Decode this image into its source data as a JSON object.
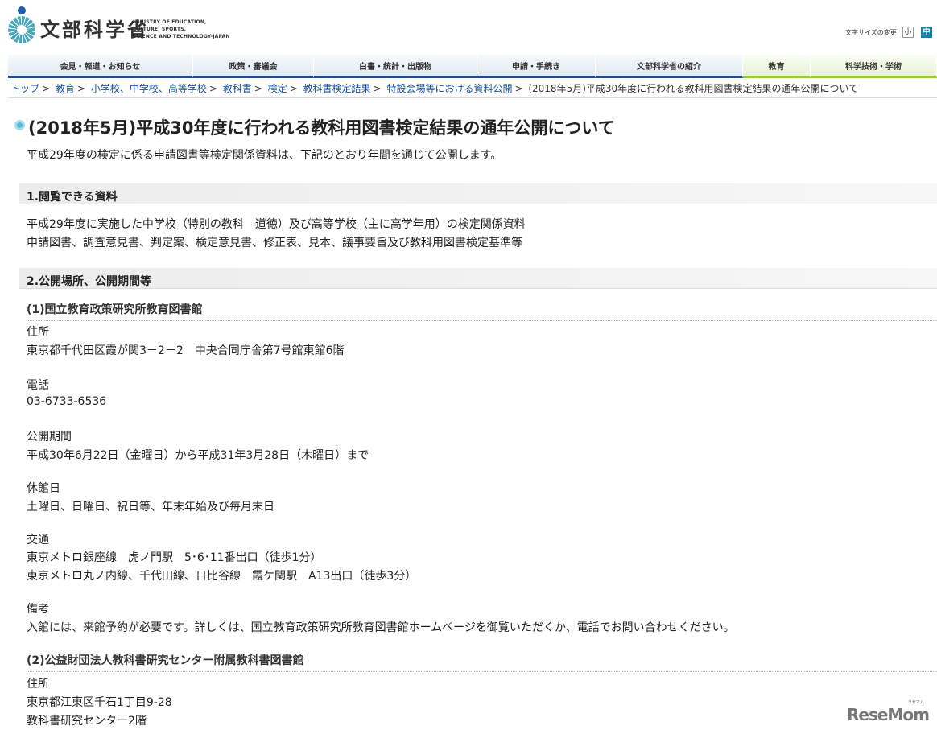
{
  "header": {
    "logo_jp": "文部科学省",
    "logo_en": [
      "MINISTRY OF EDUCATION,",
      "CULTURE, SPORTS,",
      "SCIENCE AND TECHNOLOGY-JAPAN"
    ],
    "font_size_label": "文字サイズの変更",
    "font_small": "小",
    "font_medium": "中"
  },
  "nav": [
    "会見・報道・お知らせ",
    "政策・審議会",
    "白書・統計・出版物",
    "申請・手続き",
    "文部科学省の紹介",
    "教育",
    "科学技術・学術"
  ],
  "breadcrumb": [
    "トップ",
    "教育",
    "小学校、中学校、高等学校",
    "教科書",
    "検定",
    "教科書検定結果",
    "特設会場等における資料公開"
  ],
  "breadcrumb_current": "(2018年5月)平成30年度に行われる教科用図書検定結果の通年公開について",
  "title": "(2018年5月)平成30年度に行われる教科用図書検定結果の通年公開について",
  "intro": "平成29年度の検定に係る申請図書等検定関係資料は、下記のとおり年間を通じて公開します。",
  "section1": {
    "heading": "1.閲覧できる資料",
    "lines": [
      "平成29年度に実施した中学校（特別の教科　道徳）及び高等学校（主に高学年用）の検定関係資料",
      "申請図書、調査意見書、判定案、検定意見書、修正表、見本、議事要旨及び教科用図書検定基準等"
    ]
  },
  "section2": {
    "heading": "2.公開場所、公開期間等",
    "place1": {
      "heading": "(1)国立教育政策研究所教育図書館",
      "address_label": "住所",
      "address": "東京都千代田区霞が関3－2－2　中央合同庁舎第7号館東館6階",
      "phone_label": "電話",
      "phone": "03-6733-6536",
      "period_label": "公開期間",
      "period": "平成30年6月22日（金曜日）から平成31年3月28日（木曜日）まで",
      "closed_label": "休館日",
      "closed": "土曜日、日曜日、祝日等、年末年始及び毎月末日",
      "access_label": "交通",
      "access": [
        "東京メトロ銀座線　虎ノ門駅　5･6･11番出口（徒歩1分）",
        "東京メトロ丸ノ内線、千代田線、日比谷線　霞ケ関駅　A13出口（徒歩3分）"
      ],
      "notes_label": "備考",
      "notes": "入館には、来館予約が必要です。詳しくは、国立教育政策研究所教育図書館ホームページを御覧いただくか、電話でお問い合わせください。"
    },
    "place2": {
      "heading": "(2)公益財団法人教科書研究センター附属教科書図書館",
      "address_label": "住所",
      "address": [
        "東京都江東区千石1丁目9-28",
        "教科書研究センター2階"
      ]
    }
  },
  "watermark": {
    "text": "ReseMom",
    "kana": "リセマム"
  }
}
